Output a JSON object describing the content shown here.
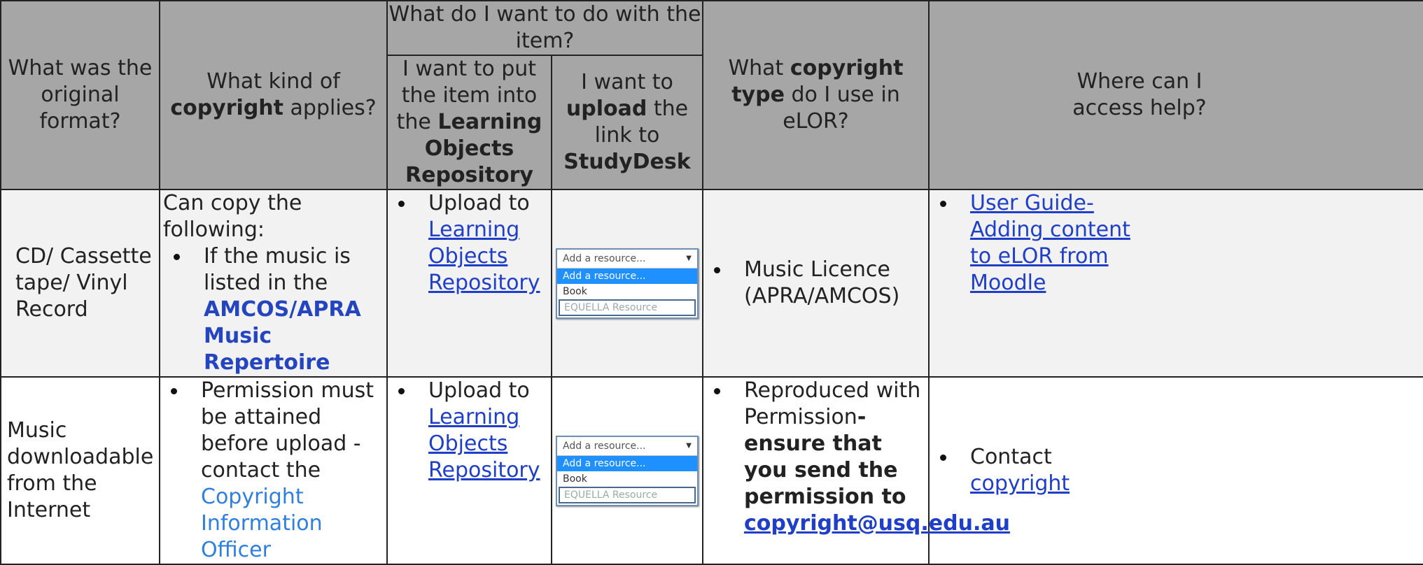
{
  "header": {
    "col1": "What was the original format?",
    "col2_pre": "What kind of ",
    "col2_bold": "copyright",
    "col2_post": " applies?",
    "col3_group": "What do I want to do with the item?",
    "col3a_pre": "I want to put the item into the ",
    "col3a_bold": "Learning Objects Repository",
    "col3b_pre": "I want to ",
    "col3b_bold1": "upload",
    "col3b_mid": " the link to ",
    "col3b_bold2": "StudyDesk",
    "col4_pre": "What ",
    "col4_bold": "copyright type",
    "col4_post": " do I use in eLOR?",
    "col5": "Where can I access help?"
  },
  "dropdown": {
    "placeholder": "Add a resource...",
    "selected": "Add a resource...",
    "option_book": "Book",
    "option_equella": "EQUELLA Resource"
  },
  "rows": [
    {
      "format": "CD/ Cassette tape/ Vinyl Record",
      "copyright_intro": "Can copy the following:",
      "copyright_bullet_pre": "If the music is listed in the ",
      "copyright_bullet_bold": "AMCOS/APRA Music Repertoire",
      "repo_pre": "Upload to ",
      "repo_link": "Learning Objects Repository",
      "type": "Music Licence (APRA/AMCOS)",
      "help_link": "User Guide- Adding content to eLOR from Moodle"
    },
    {
      "format": "Music downloadable from the Internet",
      "copyright_bullet_pre": "Permission must be attained before upload - contact the ",
      "copyright_bullet_link": "Copyright Information Officer",
      "repo_pre": "Upload to ",
      "repo_link": "Learning Objects Repository",
      "type_pre": "Reproduced with Permission",
      "type_bold": "- ensure that you send the permission to",
      "type_email": "copyright@usq.edu.au",
      "help_pre": "Contact ",
      "help_link": "copyright"
    }
  ]
}
